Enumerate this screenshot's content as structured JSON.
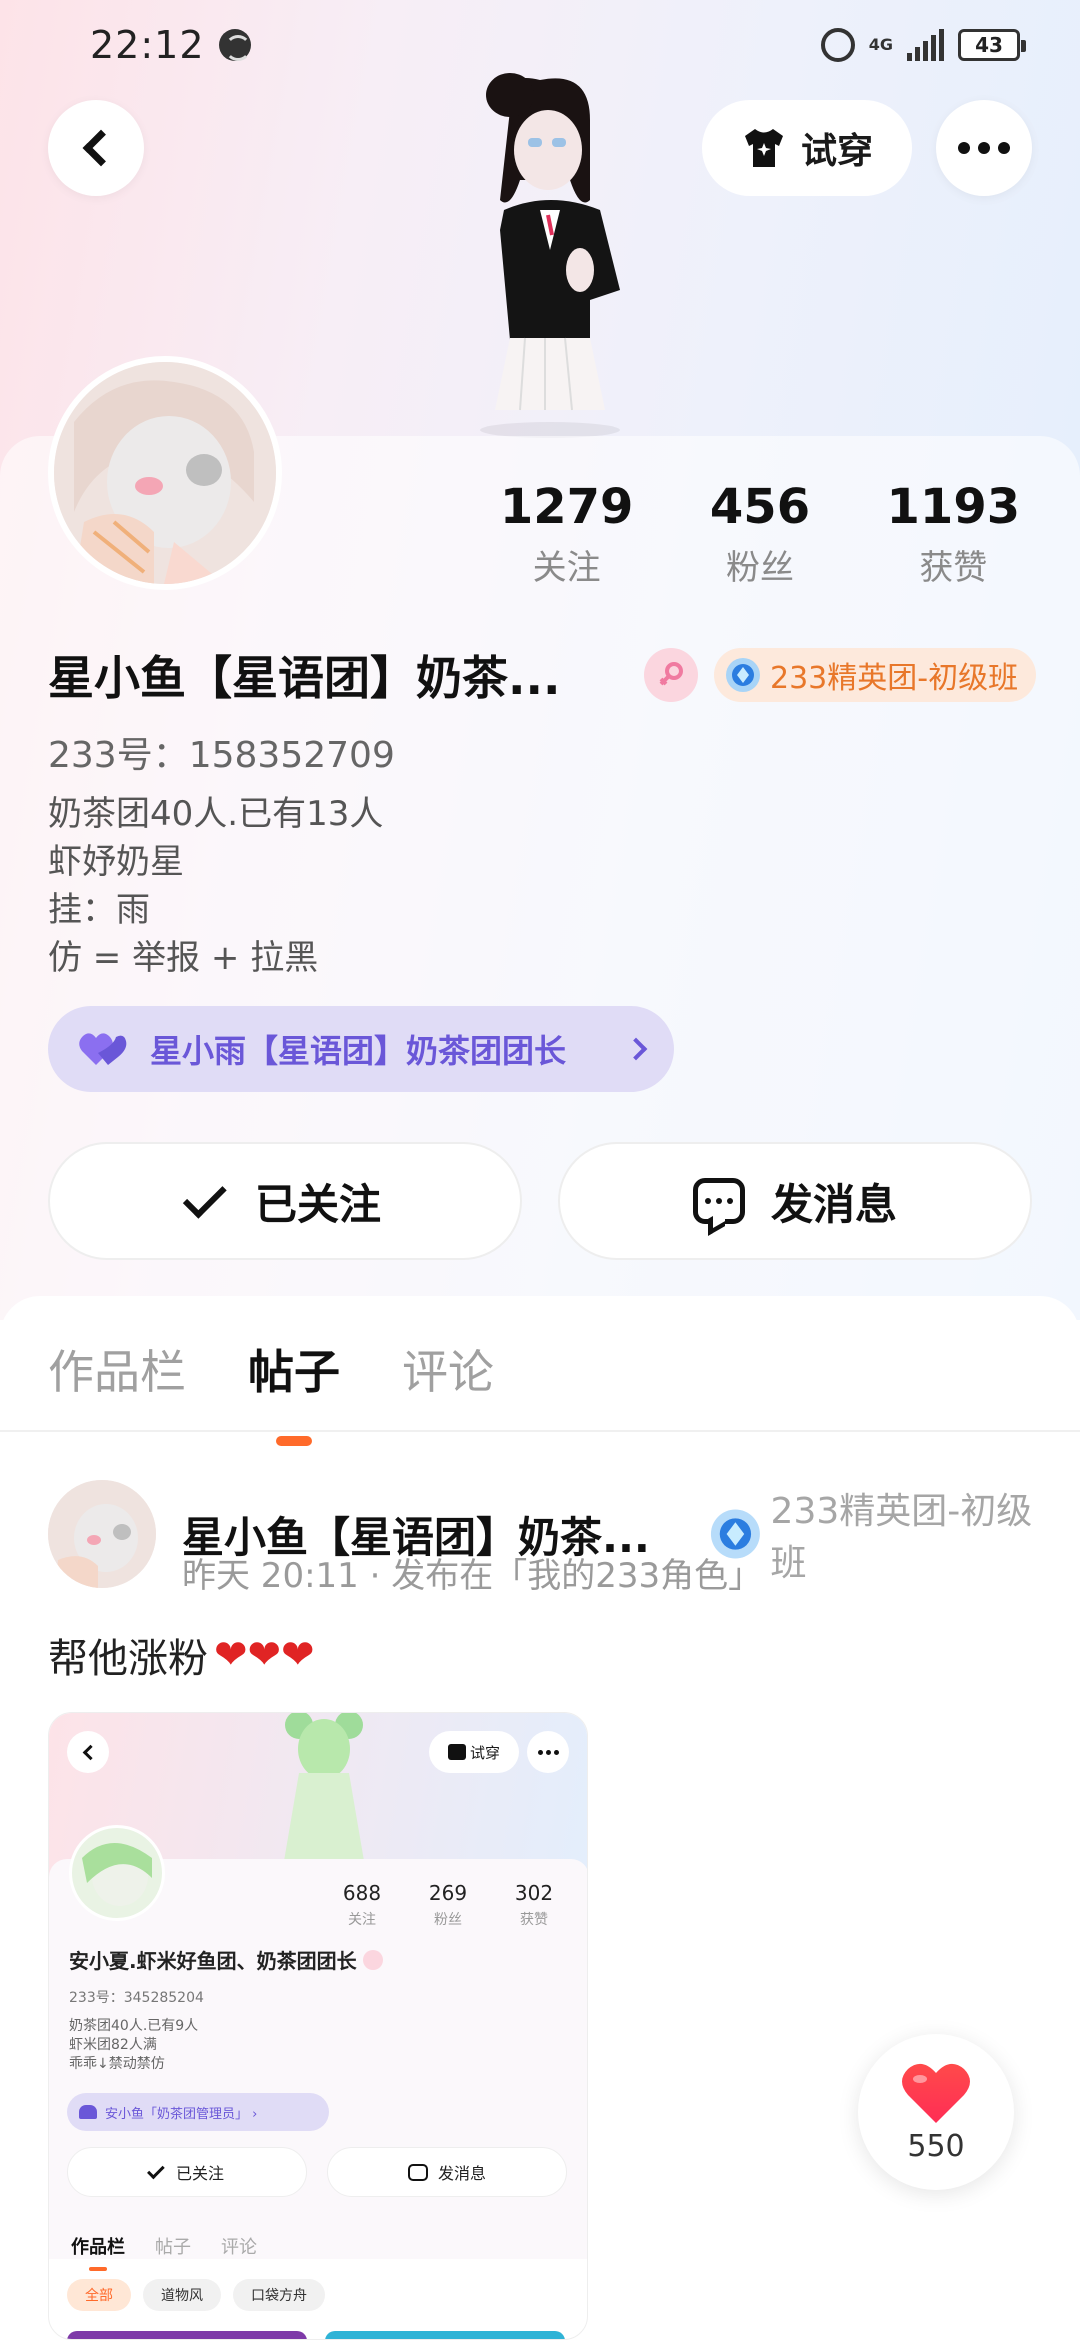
{
  "status_bar": {
    "time": "22:12",
    "network": "4G",
    "battery": "43"
  },
  "header": {
    "try_on_label": "试穿"
  },
  "profile": {
    "stats": [
      {
        "value": "1279",
        "label": "关注"
      },
      {
        "value": "456",
        "label": "粉丝"
      },
      {
        "value": "1193",
        "label": "获赞"
      }
    ],
    "name": "星小鱼【星语团】奶茶...",
    "rank_badge": "233精英团-初级班",
    "uid": "233号：158352709",
    "bio": [
      "奶茶团40人.已有13人",
      "虾妤奶星",
      "挂：雨",
      "仿 = 举报 + 拉黑"
    ],
    "group_label": "星小雨【星语团】奶茶团团长",
    "follow_label": "已关注",
    "message_label": "发消息"
  },
  "tabs": [
    {
      "label": "作品栏",
      "active": false
    },
    {
      "label": "帖子",
      "active": true
    },
    {
      "label": "评论",
      "active": false
    }
  ],
  "post": {
    "author": "星小鱼【星语团】奶茶...",
    "rank": "233精英团-初级班",
    "meta": "昨天 20:11 · 发布在「我的233角色」",
    "text": "帮他涨粉",
    "hearts": "❤❤❤",
    "image": {
      "try_label": "试穿",
      "stats": [
        {
          "value": "688",
          "label": "关注"
        },
        {
          "value": "269",
          "label": "粉丝"
        },
        {
          "value": "302",
          "label": "获赞"
        }
      ],
      "name": "安小夏.虾米好鱼团、奶茶团团长",
      "uid": "233号：345285204",
      "bio": [
        "奶茶团40人.已有9人",
        "虾米团82人满",
        "乖乖↓禁动禁仿"
      ],
      "group_label": "安小鱼「奶茶团管理员」 ›",
      "follow_label": "已关注",
      "message_label": "发消息",
      "tabs": [
        "作品栏",
        "帖子",
        "评论"
      ],
      "chips": [
        "全部",
        "道物风",
        "口袋方舟"
      ]
    }
  },
  "like": {
    "count": "550"
  },
  "colors": {
    "accent": "#ff6a2a",
    "group_purple": "#6a57d8",
    "rank_orange": "#e8772a",
    "heart_red": "#e02424"
  }
}
